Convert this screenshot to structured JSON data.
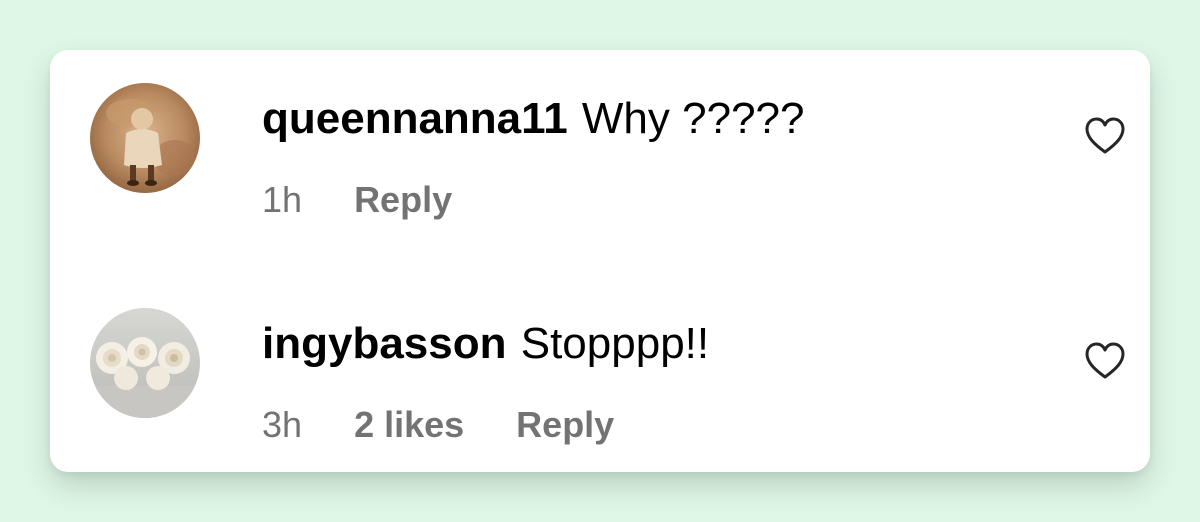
{
  "comments": [
    {
      "username": "queennanna11",
      "text": "Why ?????",
      "time": "1h",
      "reply_label": "Reply"
    },
    {
      "username": "ingybasson",
      "text": "Stopppp!!",
      "time": "3h",
      "likes": "2 likes",
      "reply_label": "Reply"
    }
  ],
  "icons": {
    "like": "heart-outline-icon"
  },
  "colors": {
    "page_background": "#dff8e6",
    "card_background": "#ffffff",
    "meta_text": "#737373",
    "primary_text": "#000000"
  }
}
